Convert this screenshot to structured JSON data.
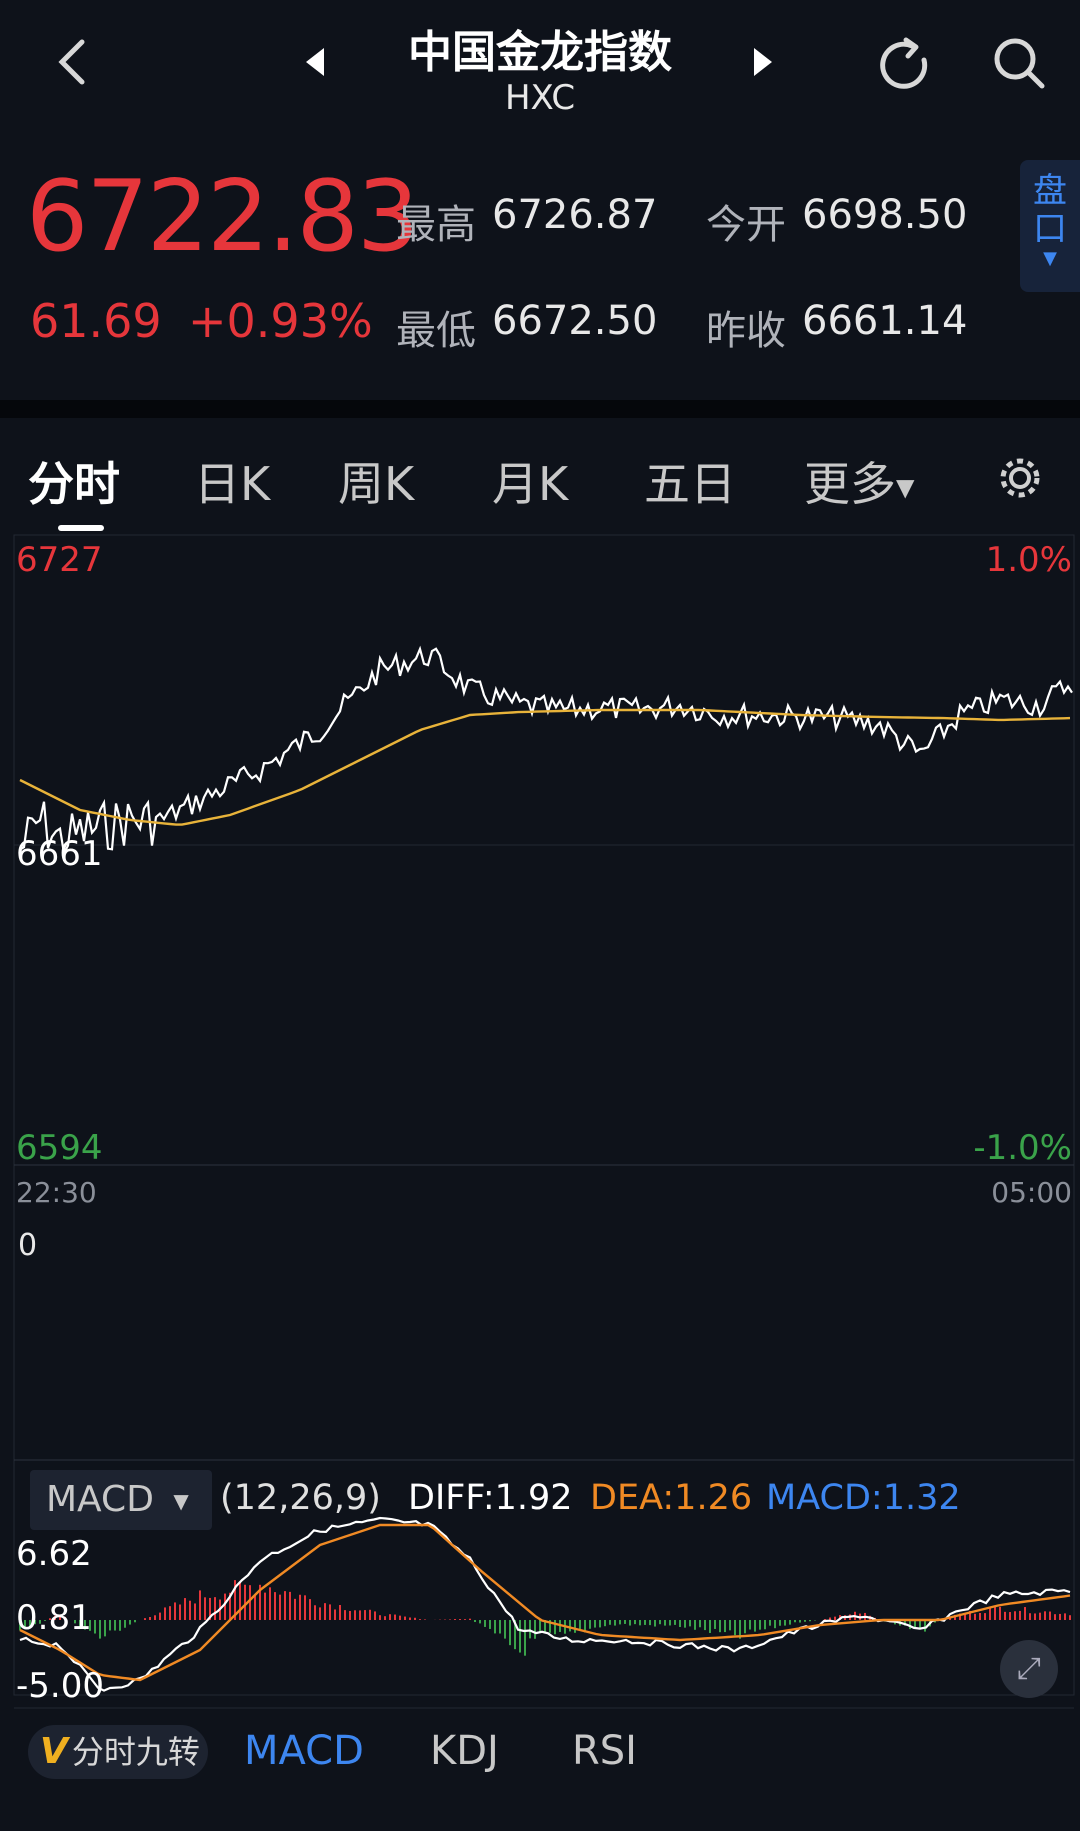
{
  "header": {
    "title": "中国金龙指数",
    "code": "HXC",
    "back_icon": "chevron-left-icon",
    "prev_icon": "triangle-left-icon",
    "next_icon": "triangle-right-icon",
    "refresh_icon": "refresh-icon",
    "search_icon": "search-icon"
  },
  "quote": {
    "price": "6722.83",
    "change": "61.69",
    "change_pct": "+0.93%",
    "high_label": "最高",
    "high": "6726.87",
    "low_label": "最低",
    "low": "6672.50",
    "open_label": "今开",
    "open": "6698.50",
    "prev_close_label": "昨收",
    "prev_close": "6661.14",
    "pankou_label": "盘口"
  },
  "tabs": [
    "分时",
    "日K",
    "周K",
    "月K",
    "五日",
    "更多"
  ],
  "active_tab": "分时",
  "chart": {
    "y_high": "6727",
    "y_mid": "6661",
    "y_low": "6594",
    "pct_high": "1.0%",
    "pct_low": "-1.0%",
    "time_start": "22:30",
    "time_end": "05:00",
    "volume_label": "0"
  },
  "indicator": {
    "name": "MACD",
    "params": "(12,26,9)",
    "diff": "DIFF:1.92",
    "dea": "DEA:1.26",
    "macd": "MACD:1.32",
    "y_top": "6.62",
    "y_mid": "0.81",
    "y_bot": "-5.00"
  },
  "bottom_tabs": {
    "nine_v": "V",
    "nine": "分时九转",
    "items": [
      "MACD",
      "KDJ",
      "RSI"
    ],
    "active": "MACD"
  },
  "colors": {
    "up": "#e6363b",
    "down": "#3aa34a",
    "price_line": "#ffffff",
    "avg_line": "#e8b33a",
    "dea_line": "#f08a24",
    "macd_blue": "#3d86f0",
    "background": "#0e121a"
  }
}
